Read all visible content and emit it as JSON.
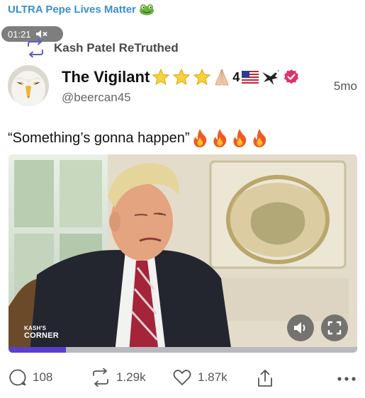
{
  "channel": {
    "title": "ULTRA Pepe Lives Matter",
    "emoji_icon": "frog-icon"
  },
  "video_timer": {
    "time": "01:21",
    "muted": true
  },
  "retruth": {
    "label": "Kash Patel ReTruthed"
  },
  "author": {
    "display_name": "The Vigilant",
    "name_suffix_number": "4",
    "handle": "@beercan45",
    "verified": true
  },
  "post": {
    "age": "5mo",
    "text": "“Something’s gonna happen”",
    "emoji_trail": [
      "fire-icon",
      "fire-icon",
      "fire-icon",
      "fire-icon"
    ]
  },
  "video": {
    "watermark_top": "KASH'S",
    "watermark_bottom": "CORNER",
    "progress": 0.165
  },
  "actions": {
    "replies": "108",
    "retruths": "1.29k",
    "likes": "1.87k"
  },
  "colors": {
    "accent": "#3a8fd1",
    "progress": "#5a3fcf",
    "verified": "#e0306a"
  }
}
